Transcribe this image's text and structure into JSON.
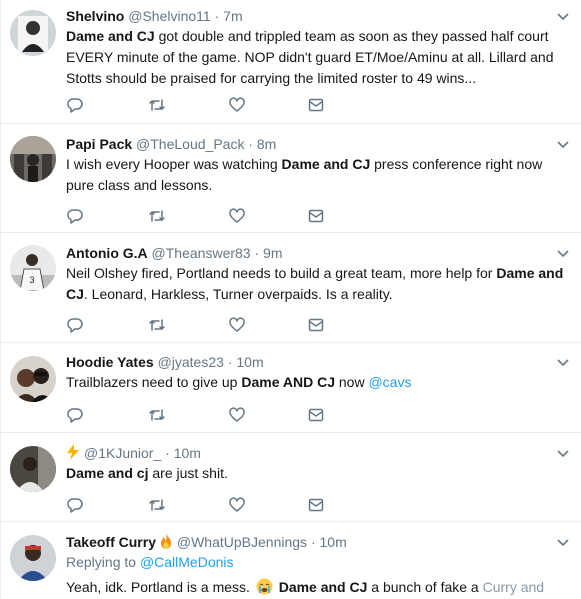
{
  "tweets": [
    {
      "name": "Shelvino",
      "handle": "@Shelvino11",
      "sep": "·",
      "time": "7m",
      "parts": [
        {
          "b": "Dame and CJ"
        },
        {
          "t": " got double and trippled team as soon as they passed half court EVERY minute of the game. NOP didn't guard ET/Moe/Aminu at all. Lillard and Stotts should be praised for carrying the limited roster to 49 wins..."
        }
      ]
    },
    {
      "name": "Papi Pack",
      "handle": "@TheLoud_Pack",
      "sep": "·",
      "time": "8m",
      "parts": [
        {
          "t": "I wish every Hooper was watching "
        },
        {
          "b": "Dame and CJ"
        },
        {
          "t": " press conference right now pure class and lessons."
        }
      ]
    },
    {
      "name": "Antonio G.A",
      "handle": "@Theanswer83",
      "sep": "·",
      "time": "9m",
      "parts": [
        {
          "t": "Neil Olshey fired, Portland needs to build a great team, more help for "
        },
        {
          "b": "Dame and CJ"
        },
        {
          "t": ". Leonard, Harkless, Turner overpaids. Is a reality."
        }
      ]
    },
    {
      "name": "Hoodie Yates",
      "handle": "@jyates23",
      "sep": "·",
      "time": "10m",
      "parts": [
        {
          "t": "Trailblazers need to give up "
        },
        {
          "b": "Dame AND CJ"
        },
        {
          "t": " now "
        },
        {
          "l": "@cavs"
        }
      ]
    },
    {
      "name": "",
      "handle": "@1KJunior_",
      "sep": "·",
      "time": "10m",
      "parts": [
        {
          "b": "Dame and cj"
        },
        {
          "t": " are just shit."
        }
      ]
    },
    {
      "name": "Takeoff Curry",
      "handle": "@WhatUpBJennings",
      "sep": "·",
      "time": "10m",
      "replying_label": "Replying to",
      "replying_to": "@CallMeDonis",
      "parts": [
        {
          "t": "Yeah, idk. Portland is a mess. "
        },
        {
          "emoji": "crying-face"
        },
        {
          "t": " "
        },
        {
          "b": "Dame and CJ"
        },
        {
          "t": " a bunch of fake a"
        },
        {
          "t": " Curry and"
        }
      ]
    }
  ],
  "colors": {
    "text": "#14171a",
    "muted": "#657786",
    "link": "#1da1f2",
    "divider": "#e6ecf0"
  }
}
